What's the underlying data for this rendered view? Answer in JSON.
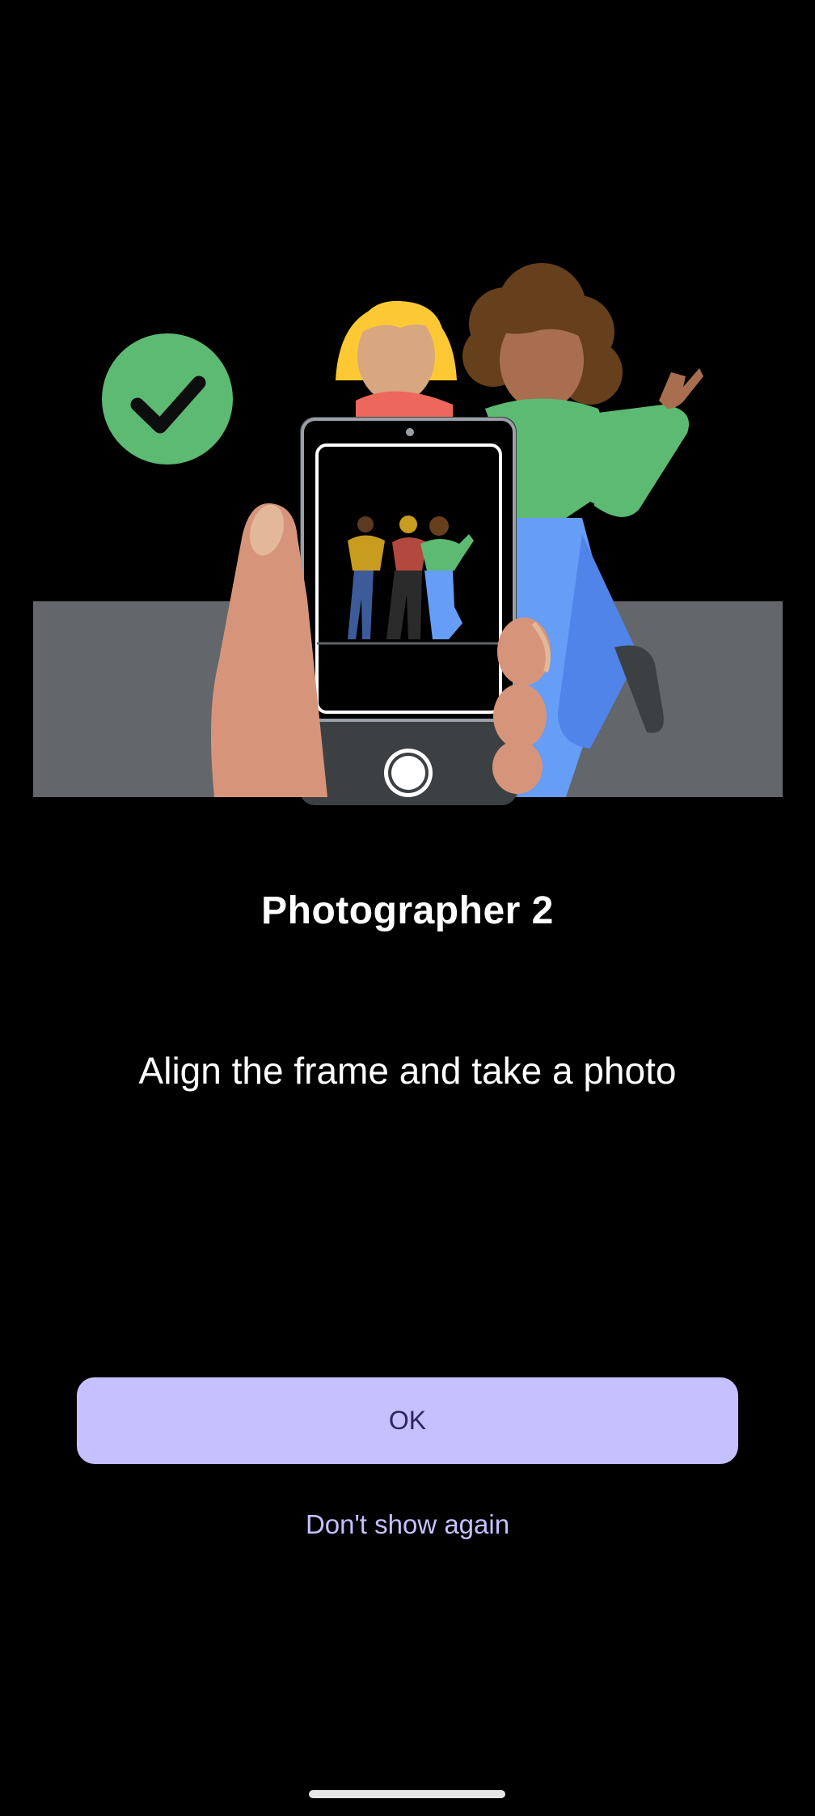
{
  "dialog": {
    "title": "Photographer 2",
    "message": "Align the frame and take a photo",
    "ok_label": "OK",
    "dont_show_label": "Don't show again"
  },
  "illustration": {
    "name": "photographer-instruction-illustration",
    "check_icon": "check-circle-icon",
    "colors": {
      "check_bg": "#5dba73",
      "floor": "#63666a",
      "accent_button": "#c5c0ff"
    }
  }
}
